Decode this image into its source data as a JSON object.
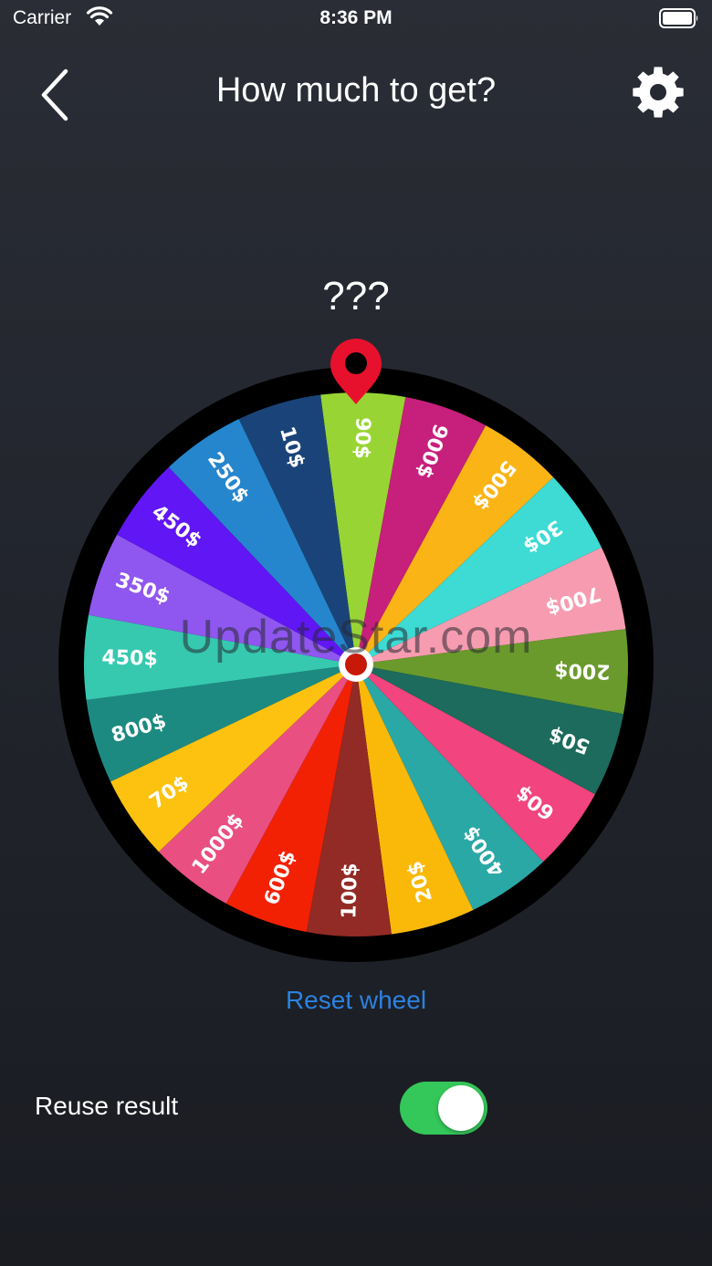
{
  "status_bar": {
    "carrier": "Carrier",
    "time": "8:36 PM"
  },
  "nav": {
    "title": "How much to get?",
    "back_icon": "chevron-left-icon",
    "settings_icon": "gear-icon"
  },
  "result": "???",
  "wheel": {
    "rotation_deg": -7.5,
    "segments": [
      {
        "label": "90$",
        "color": "#98d534"
      },
      {
        "label": "900$",
        "color": "#c71f7c"
      },
      {
        "label": "500$",
        "color": "#fbb416"
      },
      {
        "label": "30$",
        "color": "#3ddbd4"
      },
      {
        "label": "700$",
        "color": "#f79cb0"
      },
      {
        "label": "200$",
        "color": "#6a9a2c"
      },
      {
        "label": "50$",
        "color": "#1c6b5c"
      },
      {
        "label": "60$",
        "color": "#f2447e"
      },
      {
        "label": "400$",
        "color": "#2aa8a6"
      },
      {
        "label": "20$",
        "color": "#fab908"
      },
      {
        "label": "100$",
        "color": "#922a26"
      },
      {
        "label": "600$",
        "color": "#f32104"
      },
      {
        "label": "1000$",
        "color": "#ea4f82"
      },
      {
        "label": "70$",
        "color": "#fcc20f"
      },
      {
        "label": "800$",
        "color": "#1d8a82"
      },
      {
        "label": "450$",
        "color": "#36c9b0"
      },
      {
        "label": "350$",
        "color": "#8f57ef"
      },
      {
        "label": "450$",
        "color": "#6016f5"
      },
      {
        "label": "250$",
        "color": "#2586cd"
      },
      {
        "label": "10$",
        "color": "#1a4479"
      }
    ]
  },
  "watermark": "UpdateStar.com",
  "reset_label": "Reset wheel",
  "reuse": {
    "label": "Reuse result",
    "enabled": true
  },
  "colors": {
    "accent": "#2b82e0",
    "toggle_on": "#34c759",
    "pointer": "#e8112d"
  }
}
